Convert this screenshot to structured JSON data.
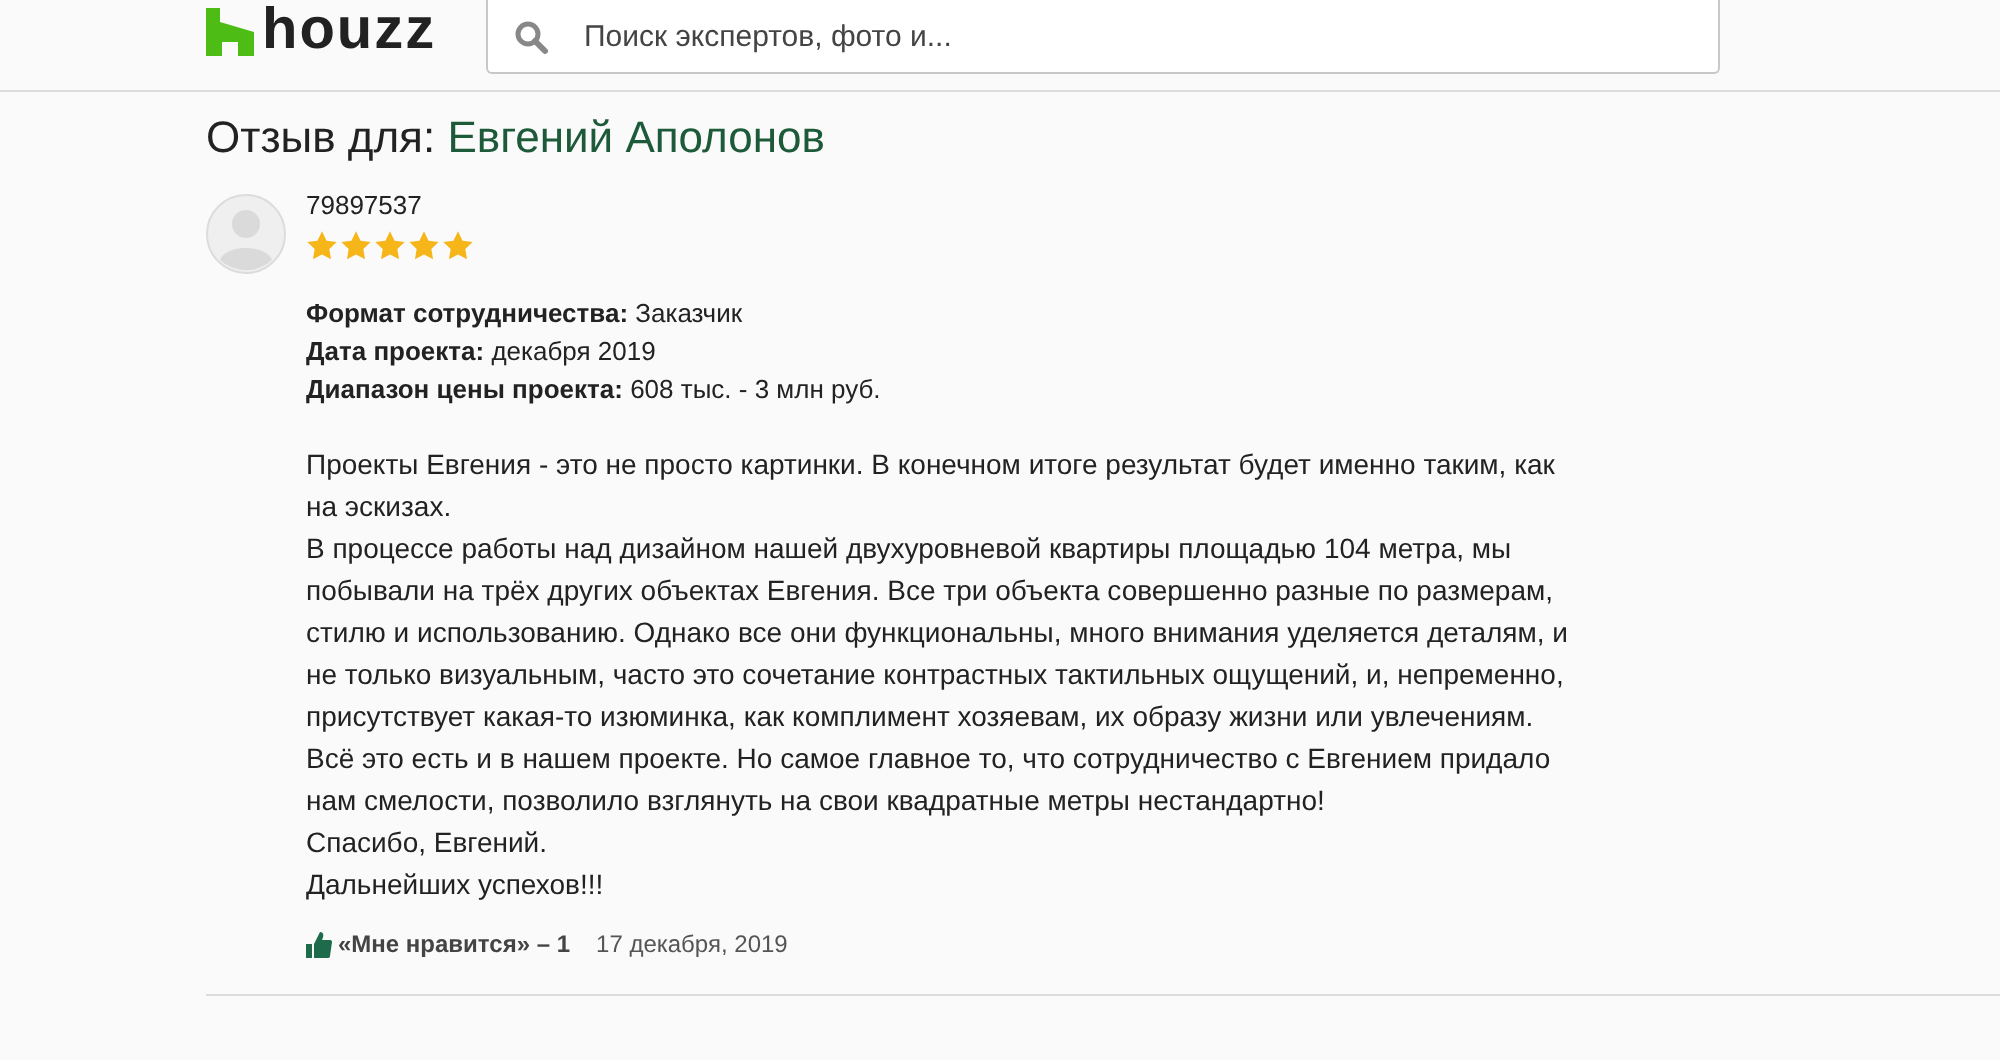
{
  "header": {
    "logo": "houzz",
    "search": {
      "placeholder": "Поиск экспертов, фото и..."
    }
  },
  "page_title": {
    "prefix": "Отзыв для:",
    "name": "Евгений Аполонов"
  },
  "review": {
    "author": "79897537",
    "stars": 5,
    "details": [
      {
        "label": "Формат сотрудничества:",
        "value": "Заказчик"
      },
      {
        "label": "Дата проекта:",
        "value": "декабря 2019"
      },
      {
        "label": "Диапазон цены проекта:",
        "value": "608 тыс. - 3 млн руб."
      }
    ],
    "paragraphs": [
      "Проекты Евгения - это не просто картинки. В конечном итоге результат будет именно таким, как на эскизах.",
      "В процессе работы над дизайном нашей двухуровневой квартиры площадью 104 метра, мы побывали на трёх других объектах Евгения. Все три объекта совершенно разные по размерам, стилю и использованию. Однако все они функциональны, много внимания уделяется деталям, и не только визуальным, часто это сочетание контрастных тактильных ощущений, и, непременно, присутствует какая-то изюминка, как комплимент хозяевам, их образу жизни или увлечениям.",
      "Всё это есть и в нашем проекте. Но самое главное то, что сотрудничество с Евгением придало нам смелости, позволило взглянуть на свои квадратные метры нестандартно!",
      "Спасибо, Евгений.",
      "Дальнейших успехов!!!"
    ],
    "like": "«Мне нравится» – 1",
    "date": "17 декабря, 2019"
  }
}
